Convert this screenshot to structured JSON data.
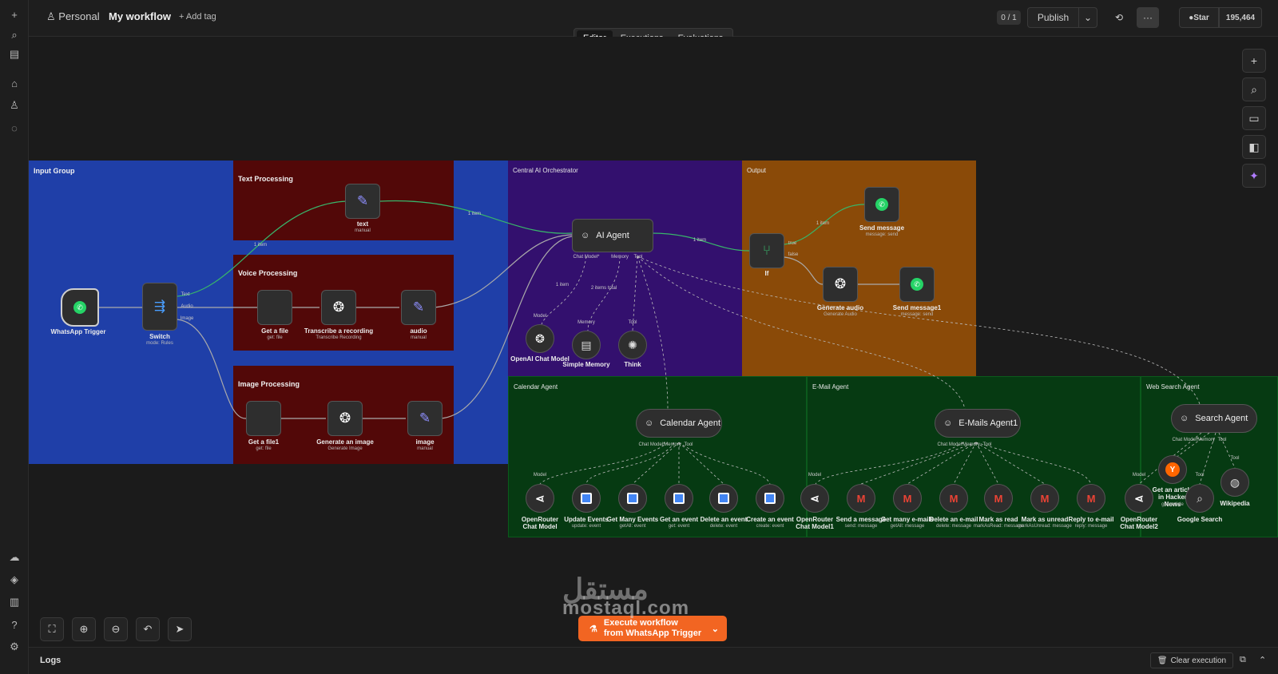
{
  "header": {
    "owner": "Personal",
    "workflow_name": "My workflow",
    "add_tag": "+ Add tag",
    "version_counter": "0 / 1",
    "publish_label": "Publish",
    "github_star": "Star",
    "github_count": "195,464",
    "more": "···"
  },
  "tabs": [
    {
      "label": "Editor",
      "active": true
    },
    {
      "label": "Executions",
      "active": false
    },
    {
      "label": "Evaluations",
      "active": false
    }
  ],
  "groups": {
    "input": "Input Group",
    "text": "Text Processing",
    "voice": "Voice Processing",
    "image": "Image Processing",
    "orchestrator": "Central AI Orchestrator",
    "output": "Output",
    "calendar": "Calendar Agent",
    "email": "E-Mail Agent",
    "websearch": "Web Search Agent"
  },
  "group_colors": {
    "input": "#1f3fa8",
    "processing": "#520808",
    "orchestrator": "#33106e",
    "output": "#8a4a08",
    "agents": "#063a12"
  },
  "nodes": {
    "whatsapp_trigger": {
      "label": "WhatsApp Trigger",
      "icon": "whatsapp-icon"
    },
    "switch": {
      "label": "Switch",
      "sub": "mode: Rules",
      "ports": [
        "Text",
        "Audio",
        "Image"
      ]
    },
    "text": {
      "label": "text",
      "sub": "manual",
      "icon": "pencil-icon"
    },
    "get_file": {
      "label": "Get a file",
      "sub": "get: file"
    },
    "transcribe": {
      "label": "Transcribe a recording",
      "sub": "Transcribe Recording",
      "icon": "openai-icon"
    },
    "audio": {
      "label": "audio",
      "sub": "manual",
      "icon": "pencil-icon"
    },
    "get_file1": {
      "label": "Get a file1",
      "sub": "get: file"
    },
    "generate_image": {
      "label": "Generate an image",
      "sub": "Generate Image",
      "icon": "openai-icon"
    },
    "image": {
      "label": "image",
      "sub": "manual",
      "icon": "pencil-icon"
    },
    "ai_agent": {
      "label": "AI Agent",
      "ports": [
        "Chat Model*",
        "Memory",
        "Tool"
      ]
    },
    "openai_chat": {
      "label": "OpenAI Chat Model",
      "port": "Model"
    },
    "simple_memory": {
      "label": "Simple Memory",
      "port": "Memory"
    },
    "think": {
      "label": "Think",
      "port": "Tool"
    },
    "if": {
      "label": "If",
      "ports": [
        "true",
        "false"
      ]
    },
    "send_message": {
      "label": "Send message",
      "sub": "message: send"
    },
    "generate_audio": {
      "label": "Generate audio",
      "sub": "Generate Audio"
    },
    "send_message1": {
      "label": "Send message1",
      "sub": "message: send"
    },
    "calendar_agent": {
      "label": "Calendar Agent",
      "ports": [
        "Chat Model*",
        "Memory",
        "Tool"
      ]
    },
    "email_agent": {
      "label": "E-Mails Agent1",
      "ports": [
        "Chat Model*",
        "Memory",
        "Tool"
      ]
    },
    "search_agent": {
      "label": "Search Agent",
      "ports": [
        "Chat Model*",
        "Memory",
        "Tool"
      ]
    }
  },
  "edge_labels": {
    "item": "1 item",
    "items_total": "2 items total"
  },
  "calendar_tools": [
    {
      "label": "OpenRouter Chat Model",
      "sub": "",
      "port": "Model",
      "icon": "openrouter-icon"
    },
    {
      "label": "Update Events",
      "sub": "update: event",
      "icon": "calendar-icon"
    },
    {
      "label": "Get Many Events",
      "sub": "getAll: event",
      "icon": "calendar-icon"
    },
    {
      "label": "Get an event",
      "sub": "get: event",
      "icon": "calendar-icon"
    },
    {
      "label": "Delete an event",
      "sub": "delete: event",
      "icon": "calendar-icon"
    },
    {
      "label": "Create an event",
      "sub": "create: event",
      "icon": "calendar-icon"
    }
  ],
  "email_tools": [
    {
      "label": "OpenRouter Chat Model1",
      "sub": "",
      "port": "Model",
      "icon": "openrouter-icon"
    },
    {
      "label": "Send a message",
      "sub": "send: message",
      "icon": "gmail-icon"
    },
    {
      "label": "Get many e-mails",
      "sub": "getAll: message",
      "icon": "gmail-icon"
    },
    {
      "label": "Delete an e-mail",
      "sub": "delete: message",
      "icon": "gmail-icon"
    },
    {
      "label": "Mark as read",
      "sub": "markAsRead: message",
      "icon": "gmail-icon"
    },
    {
      "label": "Mark as unread",
      "sub": "markAsUnread: message",
      "icon": "gmail-icon"
    },
    {
      "label": "Reply to e-mail",
      "sub": "reply: message",
      "icon": "gmail-icon"
    }
  ],
  "search_tools": [
    {
      "label": "OpenRouter Chat Model2",
      "sub": "",
      "port": "Model",
      "icon": "openrouter-icon"
    },
    {
      "label": "Get an article in Hacker News",
      "sub": "get: article",
      "icon": "hackernews-icon"
    },
    {
      "label": "Google Search",
      "sub": "",
      "port": "Tool",
      "icon": "search-icon"
    },
    {
      "label": "Wikipedia",
      "sub": "",
      "port": "Tool",
      "icon": "wikipedia-icon"
    }
  ],
  "execute": {
    "line1": "Execute workflow",
    "line2": "from WhatsApp Trigger"
  },
  "footer": {
    "logs": "Logs",
    "clear": "Clear execution"
  },
  "watermark": {
    "arabic": "مستقل",
    "latin": "mostaql.com"
  }
}
